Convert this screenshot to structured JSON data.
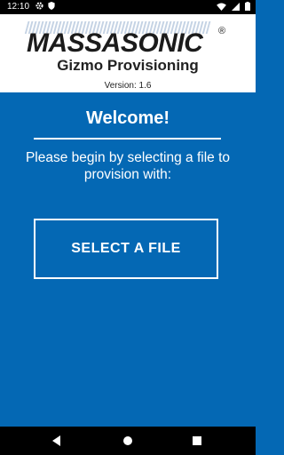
{
  "status_bar": {
    "time": "12:10",
    "left_icons": [
      "gear-icon",
      "shield-icon"
    ],
    "right_icons": [
      "wifi-icon",
      "cellular-icon",
      "battery-icon"
    ]
  },
  "header": {
    "logo_text": "MassaSonic",
    "registered_mark": "®",
    "title": "Gizmo Provisioning",
    "version": "Version: 1.6"
  },
  "main": {
    "welcome": "Welcome!",
    "instructions": "Please begin by selecting a file to provision with:",
    "select_button_label": "SELECT A FILE"
  },
  "colors": {
    "background": "#0468b4",
    "header_background": "#ffffff",
    "logo": "#1b1b1b",
    "text": "#ffffff"
  },
  "nav_bar": {
    "buttons": [
      "back-icon",
      "home-icon",
      "recents-icon"
    ]
  }
}
